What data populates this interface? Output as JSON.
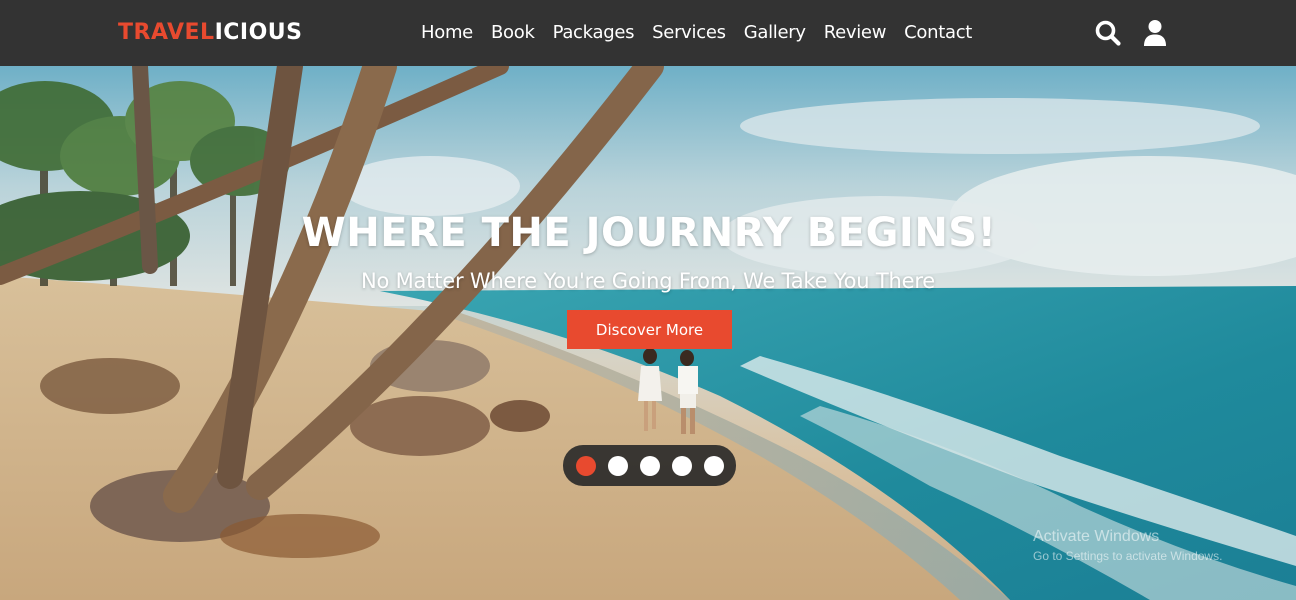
{
  "brand": {
    "part1": "TRAVEL",
    "part2": "ICIOUS",
    "color_primary": "#e84a2f"
  },
  "nav": {
    "items": [
      "Home",
      "Book",
      "Packages",
      "Services",
      "Gallery",
      "Review",
      "Contact"
    ]
  },
  "header_icons": [
    "search-icon",
    "user-icon"
  ],
  "hero": {
    "headline": "WHERE THE JOURNRY BEGINS!",
    "subheadline": "No Matter Where You're Going From, We Take You There",
    "cta_label": "Discover More",
    "slides_total": 5,
    "active_slide": 1
  },
  "watermark": {
    "line1": "Activate Windows",
    "line2": "Go to Settings to activate Windows."
  },
  "colors": {
    "header_bg": "#333333",
    "accent": "#e84a2f"
  }
}
